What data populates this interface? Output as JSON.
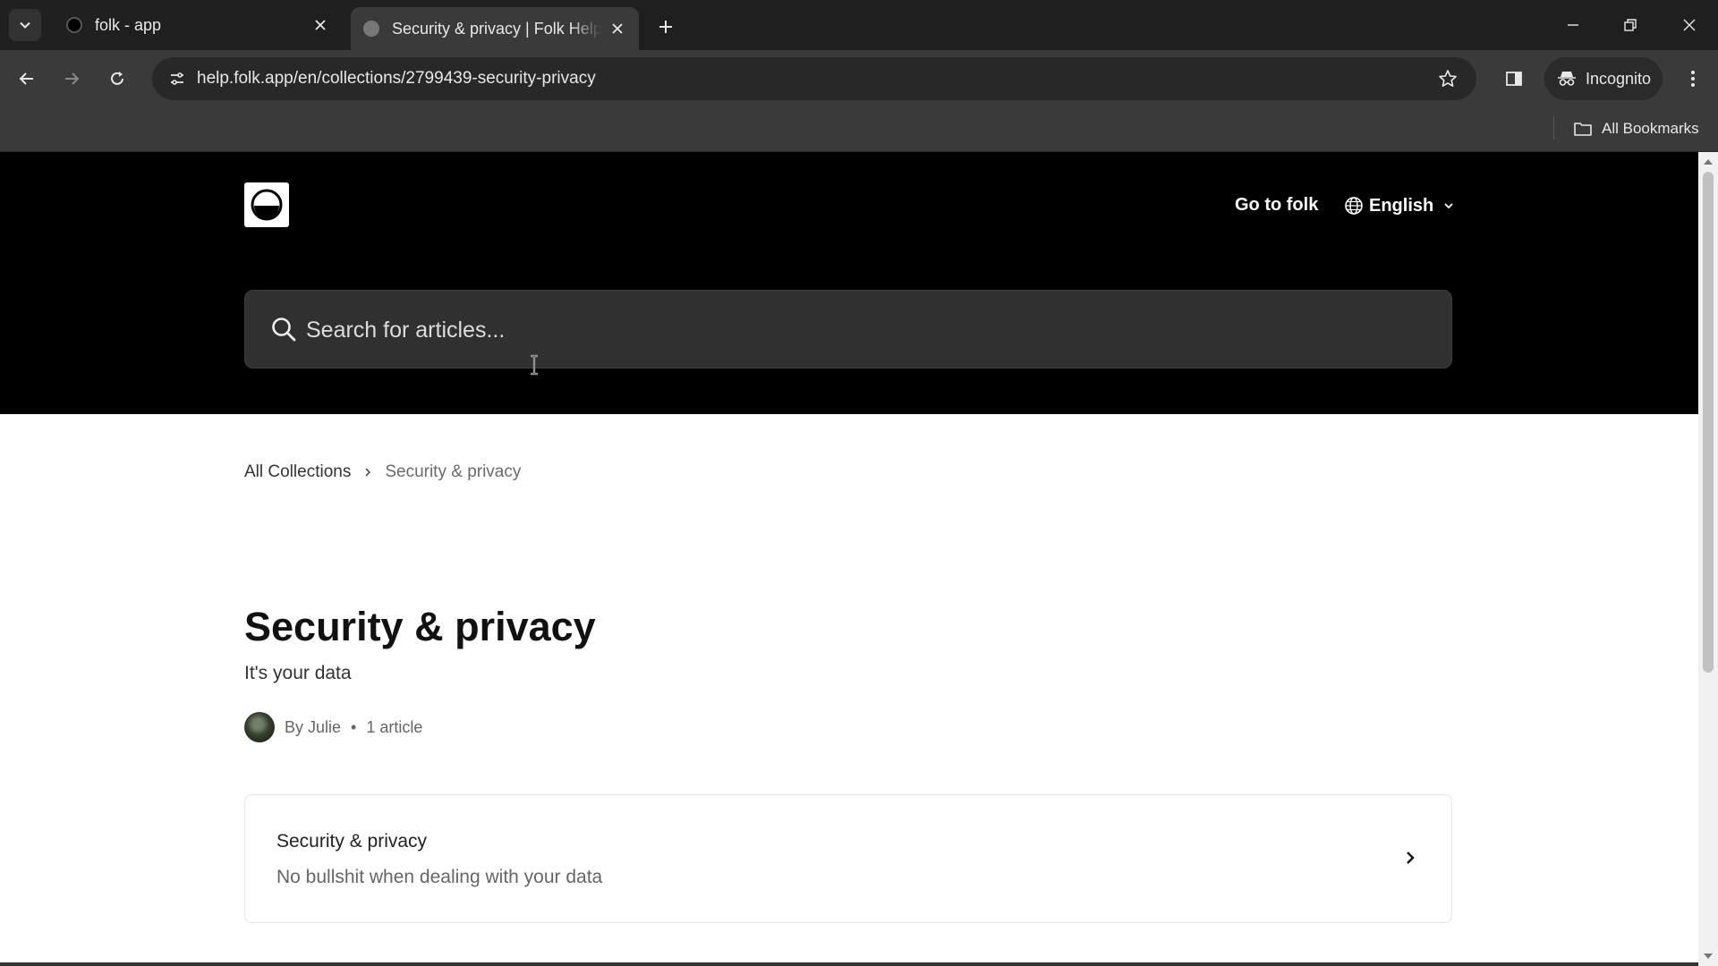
{
  "browser": {
    "tabs": [
      {
        "title": "folk - app",
        "active": false
      },
      {
        "title": "Security & privacy | Folk Help & Support",
        "active": true
      }
    ],
    "url": "help.folk.app/en/collections/2799439-security-privacy",
    "incognito_label": "Incognito",
    "bookmarks_label": "All Bookmarks"
  },
  "header": {
    "go_to_label": "Go to folk",
    "language": "English"
  },
  "search": {
    "placeholder": "Search for articles..."
  },
  "breadcrumb": {
    "home": "All Collections",
    "current": "Security & privacy"
  },
  "collection": {
    "title": "Security & privacy",
    "description": "It's your data",
    "author": "By Julie",
    "separator": "•",
    "article_count": "1 article"
  },
  "articles": [
    {
      "title": "Security & privacy",
      "description": "No bullshit when dealing with your data"
    }
  ]
}
